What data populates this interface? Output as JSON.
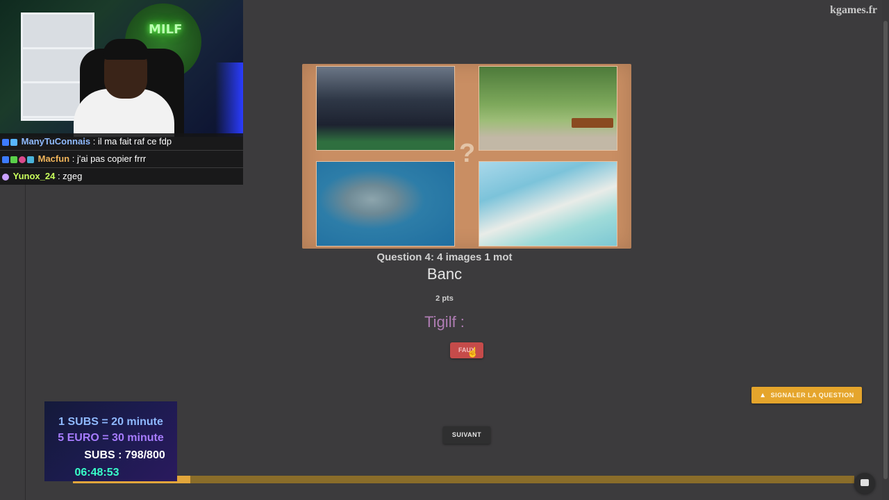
{
  "site": {
    "brand": "kgames.fr"
  },
  "stream": {
    "chat": [
      {
        "user": "ManyTuConnais",
        "message": ": il ma fait raf ce fdp",
        "color": "#8fbaff"
      },
      {
        "user": "Macfun",
        "message": ": j'ai pas copier frrr",
        "color": "#f0b45a"
      },
      {
        "user": "Yunox_24",
        "message": ": zgeg",
        "color": "#c9ff5c"
      }
    ],
    "neon_sign": "MILF",
    "subathon": {
      "line1": "1 SUBS = 20 minute",
      "line2": "5 EURO = 30 minute",
      "line3": "SUBS : 798/800",
      "timer": "06:48:53"
    }
  },
  "quiz": {
    "image_hint": "?",
    "question_title": "Question 4: 4 images 1 mot",
    "answer": "Banc",
    "points": "2 pts",
    "player_answer": "Tigilf :",
    "verdict": "FAUX",
    "report_label": "SIGNALER LA QUESTION",
    "next_label": "SUIVANT",
    "progress_fraction": 0.15
  },
  "colors": {
    "accent": "#e5a52c",
    "wrong": "#c54b4a",
    "player": "#b07db4"
  },
  "icons": [
    "warning-icon",
    "chat-icon",
    "cursor-icon"
  ]
}
